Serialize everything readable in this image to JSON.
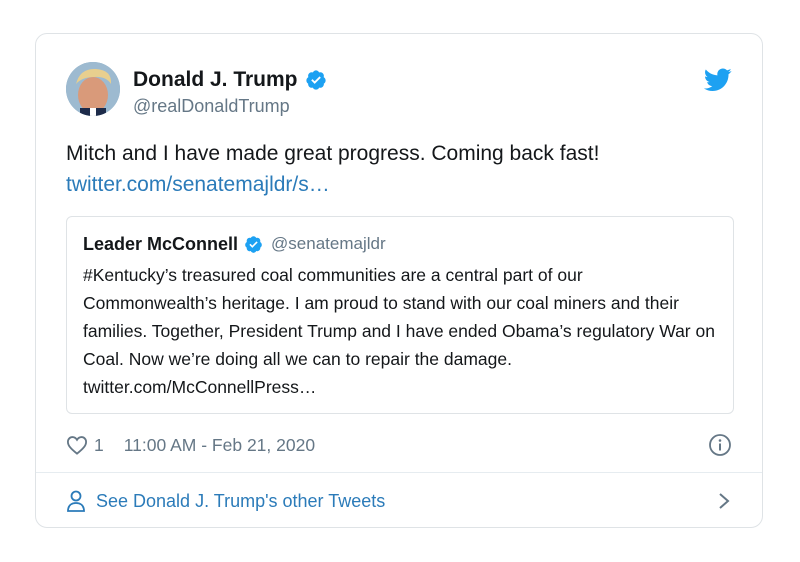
{
  "tweet": {
    "author": {
      "display_name": "Donald J. Trump",
      "handle": "@realDonaldTrump",
      "verified": true
    },
    "text": "Mitch and I have made great progress. Coming back fast!",
    "link": "twitter.com/senatemajldr/s…",
    "quoted": {
      "display_name": "Leader McConnell",
      "handle": "@senatemajldr",
      "verified": true,
      "text": "#Kentucky’s treasured coal communities are a central part of our Commonwealth’s heritage. I am proud to stand with our coal miners and their families. Together, President Trump and I have ended Obama’s regulatory War on Coal. Now we’re doing all we can to repair the damage. twitter.com/McConnellPress…"
    },
    "likes": "1",
    "timestamp": "11:00 AM - Feb 21, 2020"
  },
  "footer": {
    "see_more_label": "See Donald J. Trump's other Tweets"
  },
  "icons": {
    "verified": "verified-badge-icon",
    "brand": "twitter-bird-icon",
    "like": "heart-icon",
    "info": "info-icon",
    "user": "user-icon",
    "chevron": "chevron-right-icon"
  },
  "colors": {
    "link": "#2b7bb9",
    "verified": "#1da1f2",
    "muted": "#657786",
    "text": "#14171a",
    "border": "#dfe3e6"
  }
}
